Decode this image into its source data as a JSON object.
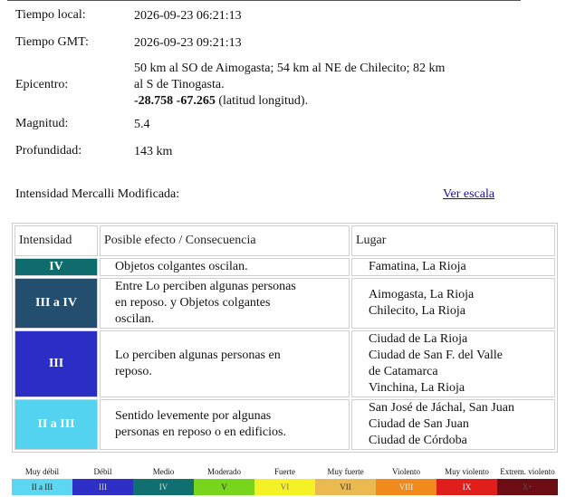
{
  "info": {
    "local_label": "Tiempo local:",
    "local_value": "2026-09-23 06:21:13",
    "gmt_label": "Tiempo GMT:",
    "gmt_value": "2026-09-23 09:21:13",
    "epicenter_label": "Epicentro:",
    "epicenter_line1": "50 km al SO de Aimogasta; 54 km al NE de Chilecito; 82 km",
    "epicenter_line2": "al S de Tinogasta.",
    "epicenter_coords": "-28.758 -67.265",
    "epicenter_coords_suffix": " (latitud longitud).",
    "magnitude_label": "Magnitud:",
    "magnitude_value": "5.4",
    "depth_label": "Profundidad:",
    "depth_value": "143 km"
  },
  "mmi": {
    "title": "Intensidad Mercalli Modificada:",
    "scale_link": "Ver escala"
  },
  "table": {
    "headers": [
      "Intensidad",
      "Posible efecto / Consecuencia",
      "Lugar"
    ],
    "rows": [
      {
        "level": "IV",
        "color": "#0e6b6e",
        "effect": [
          "Objetos colgantes oscilan."
        ],
        "places": [
          "Famatina, La Rioja"
        ]
      },
      {
        "level": "III a IV",
        "color": "#234e6e",
        "effect": [
          "Entre Lo perciben algunas personas",
          "en reposo. y Objetos colgantes",
          "oscilan."
        ],
        "places": [
          "Aimogasta, La Rioja",
          "Chilecito, La Rioja"
        ]
      },
      {
        "level": "III",
        "color": "#2b2ec4",
        "effect": [
          "Lo perciben algunas personas en",
          "reposo."
        ],
        "places": [
          "Ciudad de La Rioja",
          "Ciudad de San F. del Valle",
          "de Catamarca",
          "Vinchina, La Rioja"
        ]
      },
      {
        "level": "II a III",
        "color": "#54d3f0",
        "effect": [
          "Sentido levemente por algunas",
          "personas en reposo o en edificios."
        ],
        "places": [
          "San José de Jáchal, San Juan",
          "Ciudad de San Juan",
          "Ciudad de Córdoba"
        ]
      }
    ]
  },
  "scale": [
    {
      "name": "Muy débil",
      "code": "II a III",
      "color": "#5dd6f2",
      "text_color": "#222"
    },
    {
      "name": "Débil",
      "code": "III",
      "color": "#2d2fc6",
      "text_color": "#ddd"
    },
    {
      "name": "Medio",
      "code": "IV",
      "color": "#10706f",
      "text_color": "#ddd"
    },
    {
      "name": "Moderado",
      "code": "V",
      "color": "#77d61c",
      "text_color": "#222"
    },
    {
      "name": "Fuerte",
      "code": "VI",
      "color": "#f4f126",
      "text_color": "#777"
    },
    {
      "name": "Muy fuerte",
      "code": "VII",
      "color": "#eab94f",
      "text_color": "#333"
    },
    {
      "name": "Violento",
      "code": "VIII",
      "color": "#f08a1d",
      "text_color": "#eee"
    },
    {
      "name": "Muy violento",
      "code": "IX",
      "color": "#e01f1d",
      "text_color": "#eee"
    },
    {
      "name": "Extrem. violento",
      "code": "X+",
      "color": "#6b0d12",
      "text_color": "#555"
    }
  ]
}
